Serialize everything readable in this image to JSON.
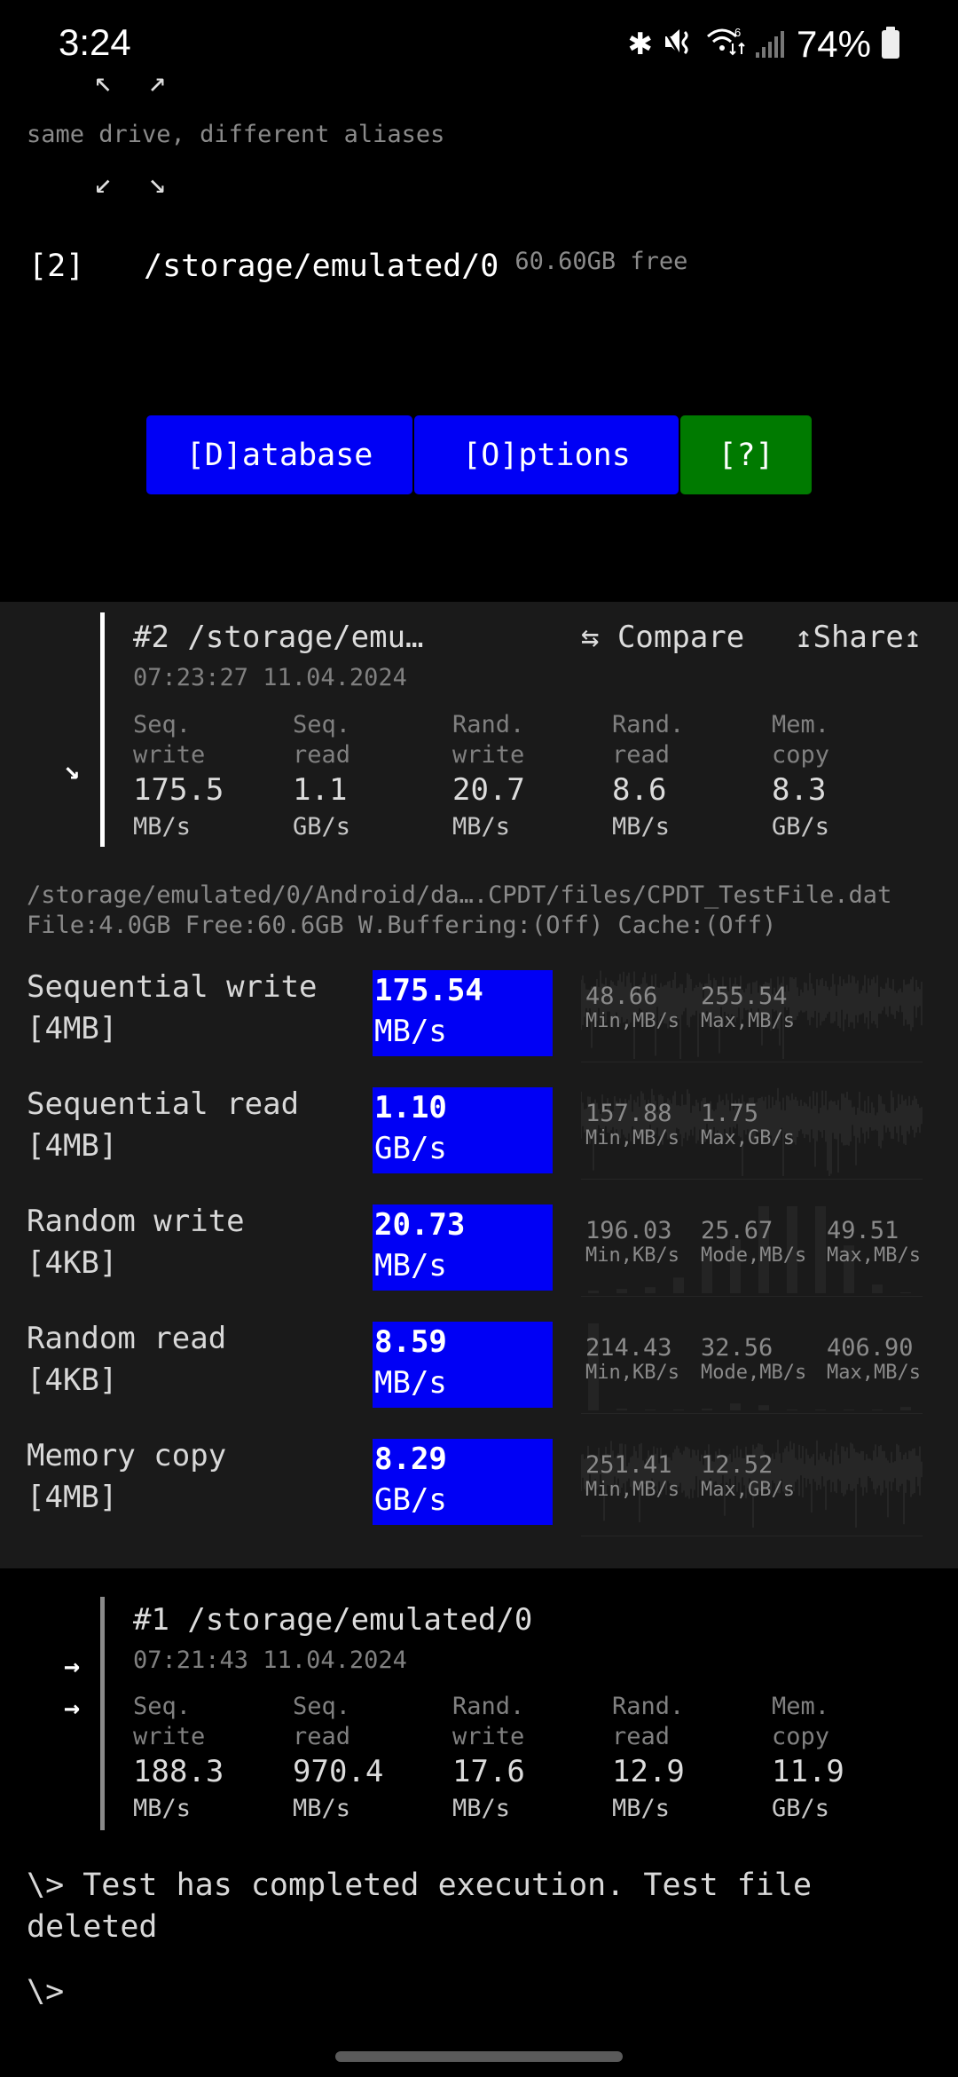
{
  "status_bar": {
    "time": "3:24",
    "icons": [
      "bluetooth-icon",
      "mute-icon",
      "wifi-6-icon",
      "signal-icon"
    ],
    "wifi_badge": "6",
    "battery_percent": "74%",
    "battery_level": 0.74
  },
  "alias_diagram": {
    "top_arrows": "↖ ↗",
    "note": "same drive, different aliases",
    "bottom_arrows": "↙ ↘"
  },
  "drive": {
    "index": "[2]",
    "path": "/storage/emulated/0",
    "free": "60.60GB free"
  },
  "buttons": {
    "database": "[D]atabase",
    "options": "[O]ptions",
    "help": "[?]"
  },
  "colors": {
    "button_blue": "#0000f5",
    "button_green": "#007a00",
    "panel_bg": "#1a1a1a"
  },
  "current_run": {
    "marker": "↘",
    "title": "#2 /storage/emu…",
    "compare_label": "⇆ Compare",
    "share_label": "↥Share↥",
    "timestamp": "07:23:27 11.04.2024",
    "columns": [
      {
        "label1": "Seq.",
        "label2": "write",
        "value": "175.5",
        "unit": "MB/s"
      },
      {
        "label1": "Seq.",
        "label2": "read",
        "value": "1.1",
        "unit": "GB/s"
      },
      {
        "label1": "Rand.",
        "label2": "write",
        "value": "20.7",
        "unit": "MB/s"
      },
      {
        "label1": "Rand.",
        "label2": "read",
        "value": "8.6",
        "unit": "MB/s"
      },
      {
        "label1": "Mem.",
        "label2": "copy",
        "value": "8.3",
        "unit": "GB/s"
      }
    ]
  },
  "details": {
    "file_path": "/storage/emulated/0/Android/da….CPDT/files/CPDT_TestFile.dat",
    "file_info": "File:4.0GB Free:60.6GB W.Buffering:(Off) Cache:(Off)",
    "tests": [
      {
        "name": "Sequential write",
        "block": "[4MB]",
        "value": "175.54",
        "unit": "MB/s",
        "graph": "sparkline",
        "stats": [
          {
            "value": "48.66",
            "label": "Min,MB/s"
          },
          {
            "value": "255.54",
            "label": "Max,MB/s"
          }
        ]
      },
      {
        "name": "Sequential read",
        "block": "[4MB]",
        "value": "1.10",
        "unit": "GB/s",
        "graph": "sparkline",
        "stats": [
          {
            "value": "157.88",
            "label": "Min,MB/s"
          },
          {
            "value": "1.75",
            "label": "Max,GB/s"
          }
        ]
      },
      {
        "name": "Random write",
        "block": "[4KB]",
        "value": "20.73",
        "unit": "MB/s",
        "graph": "histogram",
        "stats": [
          {
            "value": "196.03",
            "label": "Min,KB/s"
          },
          {
            "value": "25.67",
            "label": "Mode,MB/s"
          },
          {
            "value": "49.51",
            "label": "Max,MB/s"
          }
        ]
      },
      {
        "name": "Random read",
        "block": "[4KB]",
        "value": "8.59",
        "unit": "MB/s",
        "graph": "histogram",
        "stats": [
          {
            "value": "214.43",
            "label": "Min,KB/s"
          },
          {
            "value": "32.56",
            "label": "Mode,MB/s"
          },
          {
            "value": "406.90",
            "label": "Max,MB/s"
          }
        ]
      },
      {
        "name": "Memory copy",
        "block": "[4MB]",
        "value": "8.29",
        "unit": "GB/s",
        "graph": "sparkline",
        "stats": [
          {
            "value": "251.41",
            "label": "Min,MB/s"
          },
          {
            "value": "12.52",
            "label": "Max,GB/s"
          }
        ]
      }
    ]
  },
  "previous_run": {
    "markers": [
      "→",
      "→"
    ],
    "title": "#1 /storage/emulated/0",
    "timestamp": "07:21:43 11.04.2024",
    "columns": [
      {
        "label1": "Seq.",
        "label2": "write",
        "value": "188.3",
        "unit": "MB/s"
      },
      {
        "label1": "Seq.",
        "label2": "read",
        "value": "970.4",
        "unit": "MB/s"
      },
      {
        "label1": "Rand.",
        "label2": "write",
        "value": "17.6",
        "unit": "MB/s"
      },
      {
        "label1": "Rand.",
        "label2": "read",
        "value": "12.9",
        "unit": "MB/s"
      },
      {
        "label1": "Mem.",
        "label2": "copy",
        "value": "11.9",
        "unit": "GB/s"
      }
    ]
  },
  "console": {
    "message_line1": "\\> Test has completed execution. Test file",
    "message_line2": "deleted",
    "prompt": "\\>"
  }
}
